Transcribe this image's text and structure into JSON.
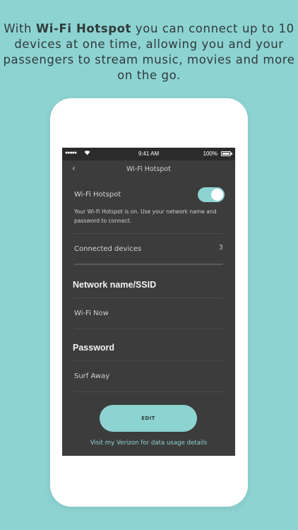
{
  "headline": {
    "prefix": "With ",
    "bold": "Wi-Fi Hotspot",
    "suffix": " you can connect up to 10 devices at one time, allowing you and your passengers to stream music, movies and more on the go."
  },
  "statusbar": {
    "signal": "●●●●●",
    "time": "9:41 AM",
    "battery": "100%"
  },
  "navbar": {
    "back": "‹",
    "title": "Wi-Fi Hotspot"
  },
  "hotspot": {
    "label": "Wi-Fi Hotspot",
    "toggle_on": true,
    "description": "Your Wi-Fi Hotspot is on.  Use your network name and password to connect."
  },
  "connected": {
    "label": "Connected devices",
    "count": "3"
  },
  "network": {
    "heading": "Network name/SSID",
    "value": "Wi-Fi Now"
  },
  "password": {
    "heading": "Password",
    "value": "Surf Away"
  },
  "actions": {
    "edit_label": "EDIT",
    "link_text": "Visit my Verizon for data usage details"
  },
  "colors": {
    "background": "#8dd3d2",
    "accent": "#8dd3d2",
    "screen": "#3c3c3c"
  }
}
